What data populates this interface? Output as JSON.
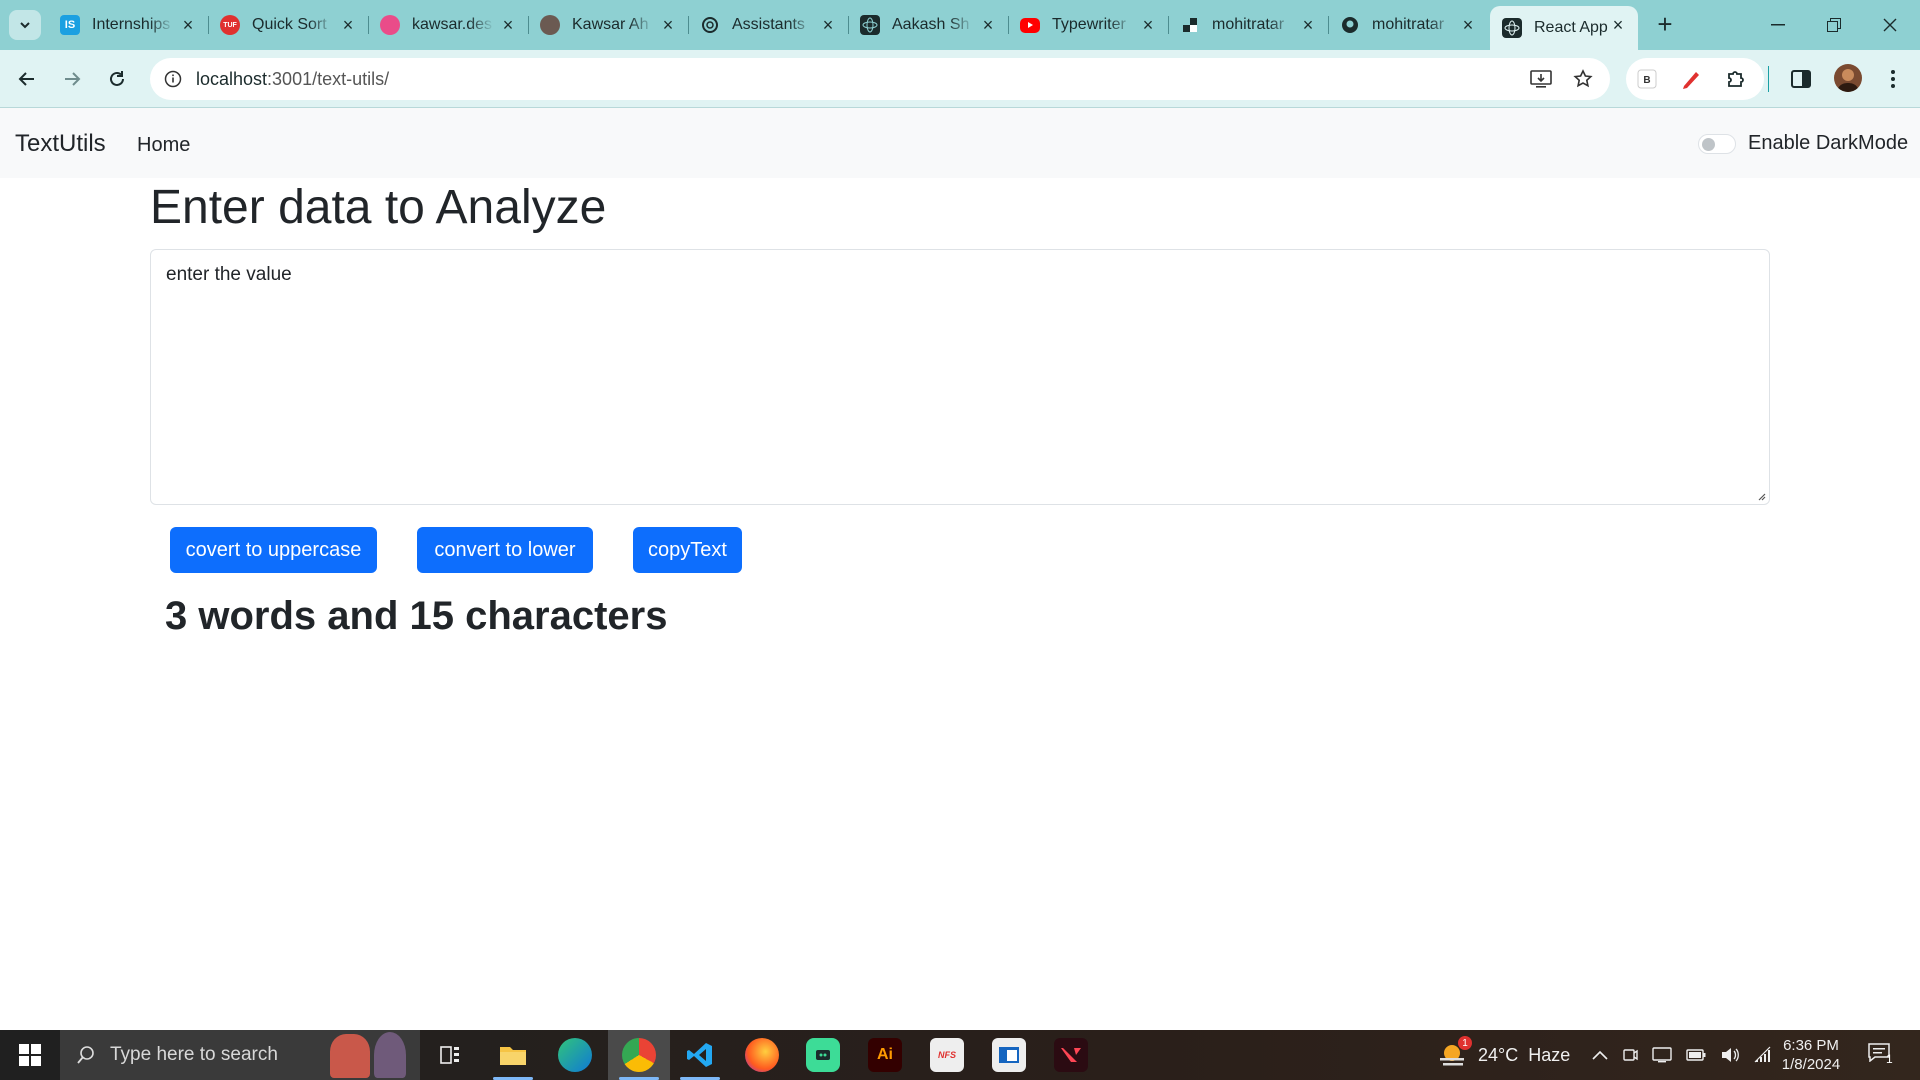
{
  "browser": {
    "tabs": [
      {
        "title": "Internships",
        "icon": "internshala-icon",
        "color": "#1ba0e1"
      },
      {
        "title": "Quick Sort",
        "icon": "takeuforward-icon",
        "color": "#e0312f"
      },
      {
        "title": "kawsar.des",
        "icon": "dribbble-icon",
        "color": "#ea4c89"
      },
      {
        "title": "Kawsar Ah",
        "icon": "profile-photo-icon",
        "color": "#555555"
      },
      {
        "title": "Assistants",
        "icon": "openai-icon",
        "color": "#1b2b2c"
      },
      {
        "title": "Aakash Sh",
        "icon": "react-icon",
        "color": "#1b2b2c"
      },
      {
        "title": "Typewriter",
        "icon": "youtube-icon",
        "color": "#ff0000"
      },
      {
        "title": "mohitratar",
        "icon": "codesandbox-icon",
        "color": "#1b2b2c"
      },
      {
        "title": "mohitratar",
        "icon": "github-icon",
        "color": "#1b2b2c"
      },
      {
        "title": "React App",
        "icon": "react-icon",
        "color": "#1b2b2c"
      }
    ],
    "url_host": "localhost",
    "url_path": ":3001/text-utils/"
  },
  "app": {
    "brand": "TextUtils",
    "nav_home": "Home",
    "darkmode_label": "Enable DarkMode",
    "heading": "Enter data to Analyze",
    "textarea_value": "enter the value",
    "buttons": {
      "upper": "covert to uppercase",
      "lower": "convert to lower",
      "copy": "copyText"
    },
    "summary": "3 words and 15 characters",
    "primary_color": "#0d6efd"
  },
  "taskbar": {
    "search_placeholder": "Type here to search",
    "weather": "24°C  Haze",
    "weather_badge": "1",
    "time": "6:36 PM",
    "date": "1/8/2024",
    "notification_count": "1"
  }
}
